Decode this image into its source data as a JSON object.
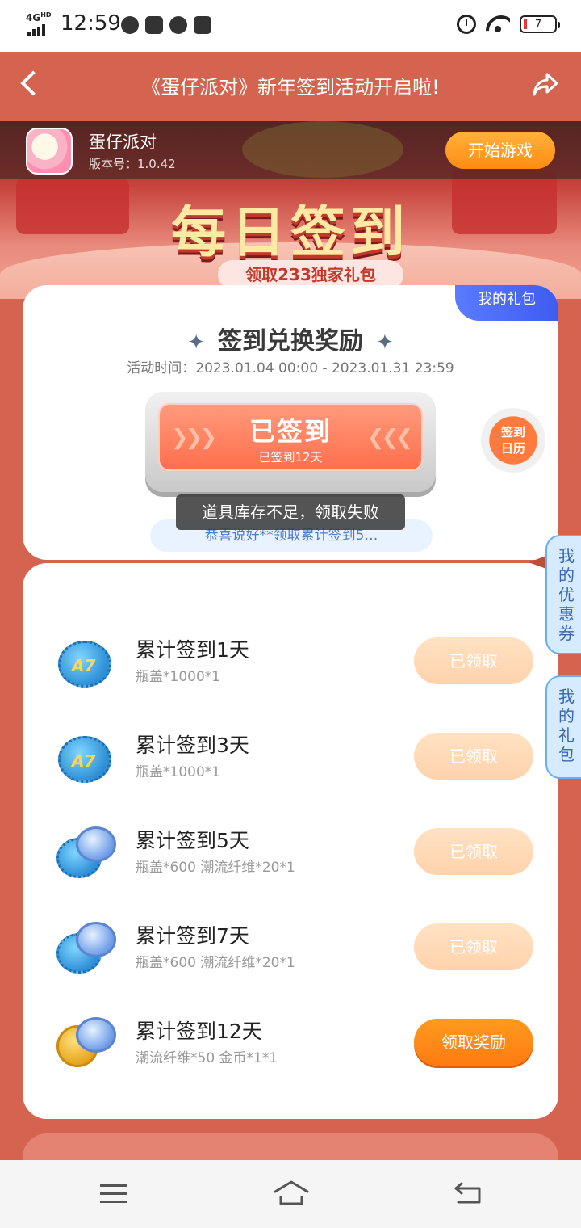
{
  "status_bar": {
    "network": "4G",
    "network_sup": "HD",
    "time": "12:59",
    "battery": "7",
    "icons": [
      "signal-icon",
      "wechat-icon",
      "video-icon",
      "browser-icon",
      "storage-icon",
      "alarm-icon",
      "wifi-icon",
      "battery-icon"
    ]
  },
  "header": {
    "title": "《蛋仔派对》新年签到活动开启啦!"
  },
  "game": {
    "name": "蛋仔派对",
    "version": "版本号：1.0.42",
    "start_label": "开始游戏"
  },
  "banner": {
    "title": "每日签到",
    "subtitle": "领取233独家礼包"
  },
  "checkin": {
    "gift_tag": "我的礼包",
    "title": "签到兑换奖励",
    "time": "活动时间：2023.01.04 00:00 - 2023.01.31 23:59",
    "button_main": "已签到",
    "button_sub": "已签到12天",
    "calendar_l1": "签到",
    "calendar_l2": "日历",
    "congrats": "恭喜说好**领取累计签到5…",
    "toast": "道具库存不足，领取失败"
  },
  "rewards": [
    {
      "title": "累计签到1天",
      "items": "瓶盖*1000*1",
      "button": "已领取",
      "status": "done",
      "icon": "blue-cap-icon"
    },
    {
      "title": "累计签到3天",
      "items": "瓶盖*1000*1",
      "button": "已领取",
      "status": "done",
      "icon": "blue-cap-icon"
    },
    {
      "title": "累计签到5天",
      "items": "瓶盖*600 潮流纤维*20*1",
      "button": "已领取",
      "status": "done",
      "icon": "cap-fiber-icon"
    },
    {
      "title": "累计签到7天",
      "items": "瓶盖*600 潮流纤维*20*1",
      "button": "已领取",
      "status": "done",
      "icon": "cap-fiber-icon"
    },
    {
      "title": "累计签到12天",
      "items": "潮流纤维*50 金币*1*1",
      "button": "领取奖励",
      "status": "active",
      "icon": "coin-fiber-icon"
    }
  ],
  "side_tabs": {
    "coupons": [
      "我",
      "的",
      "优",
      "惠",
      "券"
    ],
    "gifts": [
      "我",
      "的",
      "礼",
      "包"
    ]
  },
  "colors": {
    "page_bg": "#d4634f",
    "accent_orange": "#ff7b12",
    "done_button": "#ffd9b8",
    "gift_tag_blue": "#3e5cf0"
  }
}
